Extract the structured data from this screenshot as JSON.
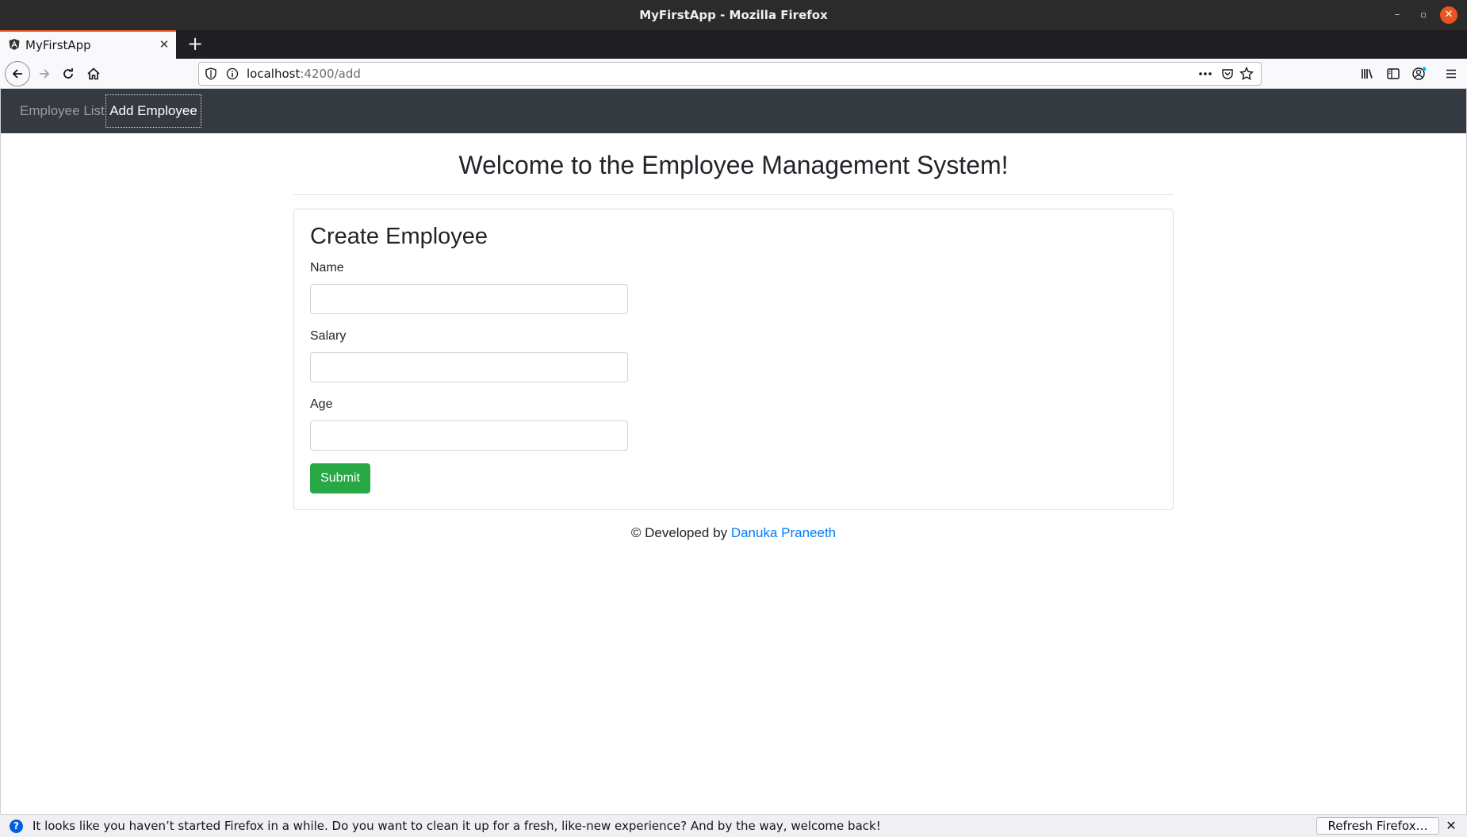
{
  "window": {
    "title": "MyFirstApp - Mozilla Firefox",
    "minimize_glyph": "–",
    "maximize_glyph": "▫",
    "close_glyph": "✕"
  },
  "tabs": [
    {
      "title": "MyFirstApp",
      "close_glyph": "✕",
      "favicon": "angular-icon"
    }
  ],
  "tabbar": {
    "new_tab_glyph": "+"
  },
  "toolbar": {
    "url_host": "localhost",
    "url_path": ":4200/add",
    "icons": [
      "back-icon",
      "forward-icon",
      "reload-icon",
      "home-icon",
      "shield-icon",
      "info-icon",
      "more-icon",
      "pocket-icon",
      "bookmark-star-icon",
      "library-icon",
      "sidebar-icon",
      "account-icon",
      "menu-icon"
    ]
  },
  "app_nav": {
    "links": [
      "Employee List",
      "Add Employee"
    ],
    "active": "Add Employee"
  },
  "page": {
    "heading": "Welcome to the Employee Management System!"
  },
  "form": {
    "title": "Create Employee",
    "fields": [
      {
        "label": "Name",
        "value": ""
      },
      {
        "label": "Salary",
        "value": ""
      },
      {
        "label": "Age",
        "value": ""
      }
    ],
    "submit_label": "Submit",
    "submit_color": "#28a745"
  },
  "footer": {
    "prefix": "© Developed by",
    "author": "Danuka Praneeth",
    "link_color": "#007bff"
  },
  "notification": {
    "message": "It looks like you haven’t started Firefox in a while. Do you want to clean it up for a fresh, like-new experience? And by the way, welcome back!",
    "button_label": "Refresh Firefox…",
    "icon_glyph": "?",
    "close_glyph": "✕"
  },
  "colors": {
    "app_nav_bg": "#343a40",
    "accent_tab": "#e95420"
  }
}
